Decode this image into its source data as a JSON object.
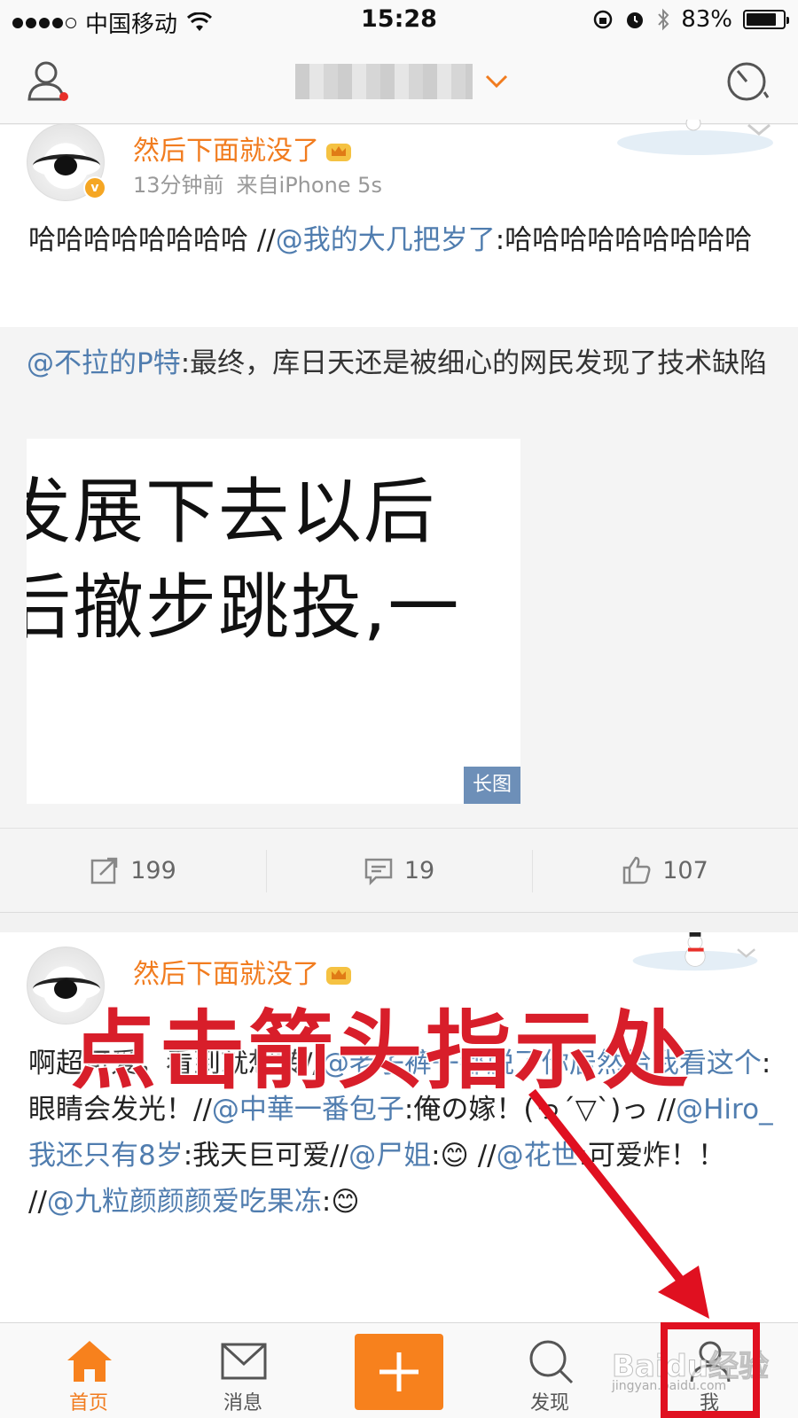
{
  "status_bar": {
    "carrier": "中国移动",
    "time": "15:28",
    "battery": "83%",
    "battery_level": 0.83
  },
  "nav": {
    "user_icon": "user-icon",
    "title_icon": "blurred-title",
    "chevron_icon": "chevron-down-icon",
    "radar_icon": "radar-icon"
  },
  "post1": {
    "username": "然后下面就没了",
    "time": "13分钟前",
    "source": "来自iPhone 5s",
    "text_prefix": "哈哈哈哈哈哈哈哈 //",
    "mention": "@我的大几把岁了",
    "text_suffix": ":哈哈哈哈哈哈哈哈哈",
    "retweet": {
      "mention": "@不拉的P特",
      "text": ":最终，库日天还是被细心的网民发现了技术缺陷",
      "image_line1": "发展下去以后",
      "image_line2": "后撤步跳投,一",
      "image_badge": "长图"
    },
    "actions": {
      "repost_count": "199",
      "comment_count": "19",
      "like_count": "107"
    }
  },
  "post2": {
    "username": "然后下面就没了",
    "segments": [
      {
        "t": "啊",
        "m": false
      },
      {
        "t": "超可爱，看到就想转//",
        "m": false
      },
      {
        "t": "@老子裤子都脱了你居然给我看这个",
        "m": true
      },
      {
        "t": ":眼睛会发光！//",
        "m": false
      },
      {
        "t": "@中華一番包子",
        "m": true
      },
      {
        "t": ":俺の嫁！(っ´▽`)っ //",
        "m": false
      },
      {
        "t": "@Hiro_我还只有8岁",
        "m": true
      },
      {
        "t": ":我天巨可爱//",
        "m": false
      },
      {
        "t": "@尸姐",
        "m": true
      },
      {
        "t": ":😊 //",
        "m": false
      },
      {
        "t": "@花世",
        "m": true
      },
      {
        "t": ":可爱炸！！ //",
        "m": false
      },
      {
        "t": "@九粒颜颜颜爱吃果冻",
        "m": true
      },
      {
        "t": ":😊",
        "m": false
      }
    ]
  },
  "overlay": {
    "instruction": "点击箭头指示处",
    "watermark": "Baidu经验",
    "watermark_sub": "jingyan.baidu.com"
  },
  "tabbar": {
    "home": "首页",
    "messages": "消息",
    "discover": "发现",
    "me": "我"
  },
  "colors": {
    "accent_orange": "#f7811d",
    "mention_blue": "#507daf",
    "annotation_red": "#d81e2a"
  }
}
